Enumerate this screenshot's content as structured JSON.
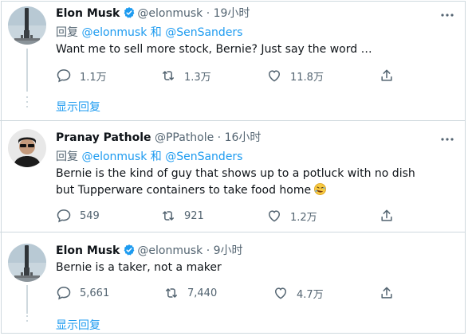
{
  "tweets": [
    {
      "name": "Elon Musk",
      "verified": true,
      "handle": "@elonmusk",
      "time": "· 19小时",
      "reply_prefix": "回复",
      "reply_to_1": "@elonmusk",
      "reply_joiner": "和",
      "reply_to_2": "@SenSanders",
      "text": "Want me to sell more stock, Bernie? Just say the word …",
      "replies": "1.1万",
      "retweets": "1.3万",
      "likes": "11.8万",
      "show_replies": "显示回复"
    },
    {
      "name": "Pranay Pathole",
      "verified": false,
      "handle": "@PPathole",
      "time": "· 16小时",
      "reply_prefix": "回复",
      "reply_to_1": "@elonmusk",
      "reply_joiner": "和",
      "reply_to_2": "@SenSanders",
      "text": "Bernie is the kind of guy that shows up to a potluck with no dish but Tupperware containers to take food home",
      "emoji": "rofl",
      "replies": "549",
      "retweets": "921",
      "likes": "1.2万"
    },
    {
      "name": "Elon Musk",
      "verified": true,
      "handle": "@elonmusk",
      "time": "· 9小时",
      "text": "Bernie is a taker, not a maker",
      "replies": "5,661",
      "retweets": "7,440",
      "likes": "4.7万",
      "show_replies": "显示回复"
    }
  ],
  "colors": {
    "accent": "#1d9bf0",
    "muted": "#536471",
    "border": "#cfd9de"
  }
}
